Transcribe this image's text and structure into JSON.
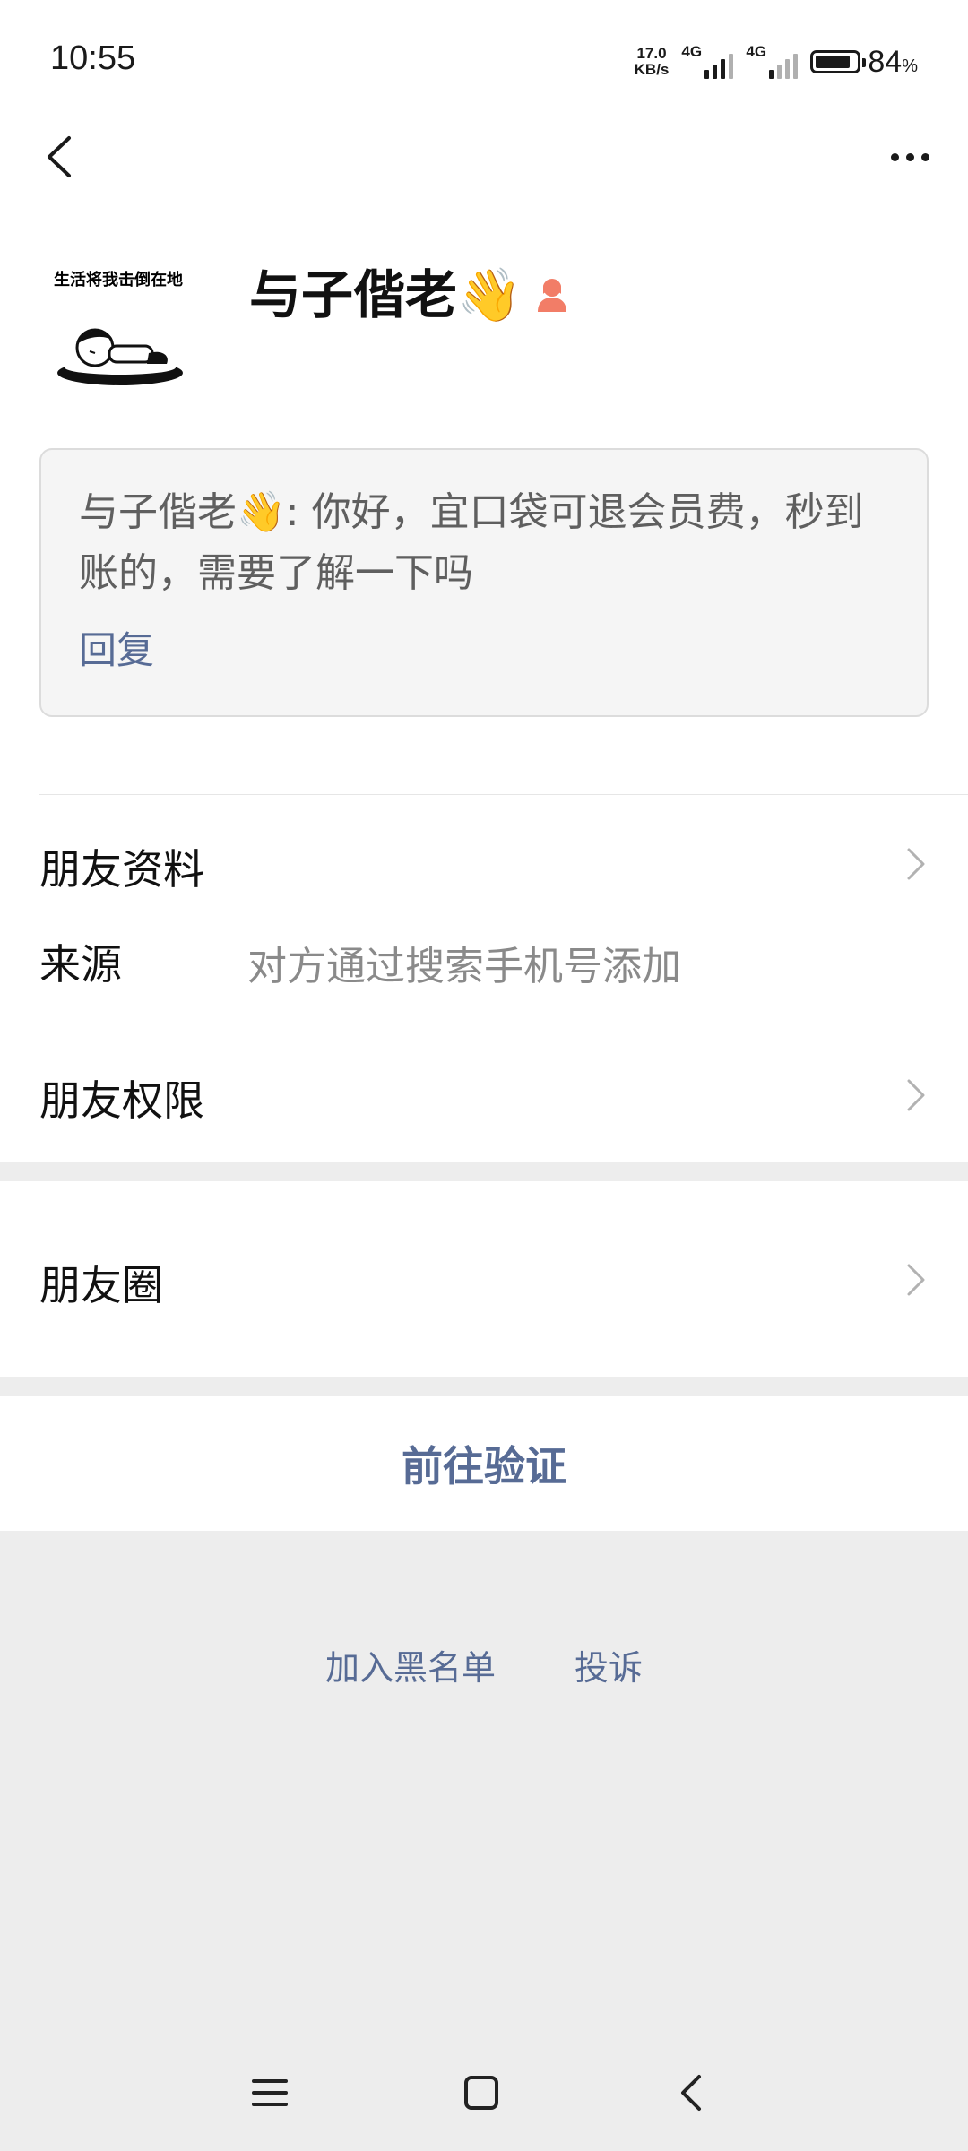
{
  "status_bar": {
    "time": "10:55",
    "net_speed_value": "17.0",
    "net_speed_unit": "KB/s",
    "sim1_label": "4G",
    "sim2_label": "4G",
    "battery_percent": "84",
    "battery_unit": "%"
  },
  "nav": {
    "back_icon": "chevron-left-icon",
    "more_icon": "more-dots-icon"
  },
  "profile": {
    "avatar_caption": "生活将我击倒在地",
    "display_name": "与子偕老👋",
    "gender_icon": "female-person-icon"
  },
  "greeting": {
    "message": "与子偕老👋: 你好，宜口袋可退会员费，秒到账的，需要了解一下吗",
    "reply_label": "回复"
  },
  "rows": {
    "friend_info_label": "朋友资料",
    "source_label": "来源",
    "source_value": "对方通过搜索手机号添加",
    "permissions_label": "朋友权限",
    "moments_label": "朋友圈"
  },
  "verify_label": "前往验证",
  "bottom_links": {
    "blacklist_label": "加入黑名单",
    "report_label": "投诉"
  },
  "colors": {
    "link_blue": "#576b95",
    "background": "#ededed",
    "female_icon": "#f27d67"
  }
}
